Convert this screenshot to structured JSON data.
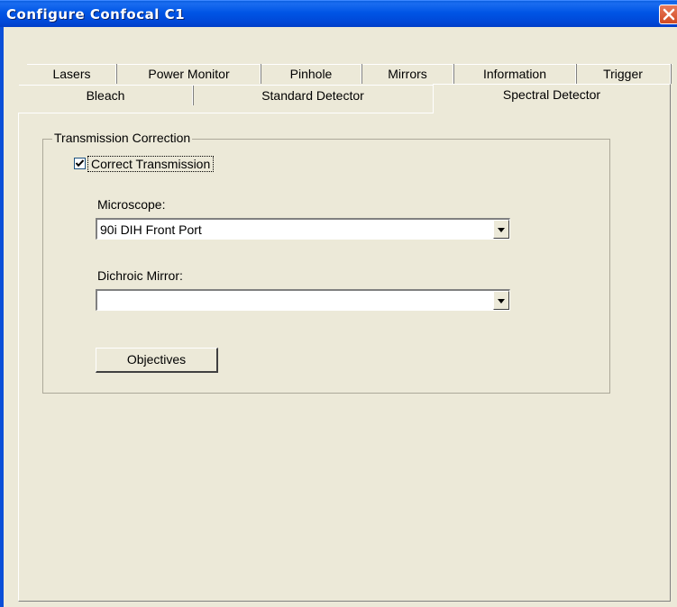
{
  "window": {
    "title": "Configure Confocal C1"
  },
  "tabs": {
    "row_top": [
      "Lasers",
      "Power Monitor",
      "Pinhole",
      "Mirrors",
      "Information",
      "Trigger"
    ],
    "row_bottom": [
      "Bleach",
      "Standard Detector",
      "Spectral Detector"
    ],
    "active": "Spectral Detector"
  },
  "transmission": {
    "group_label": "Transmission Correction",
    "checkbox_label": "Correct Transmission",
    "checkbox_checked": true,
    "microscope_label": "Microscope:",
    "microscope_value": "90i DIH  Front Port",
    "dichroic_label": "Dichroic Mirror:",
    "dichroic_value": "",
    "objectives_button": "Objectives"
  },
  "colors": {
    "titlebar": "#0055e5",
    "face": "#ece9d8",
    "close": "#d14a22"
  },
  "icons": {
    "close": "close-x-icon",
    "check": "checkmark-icon",
    "dropdown": "triangle-down-icon"
  }
}
